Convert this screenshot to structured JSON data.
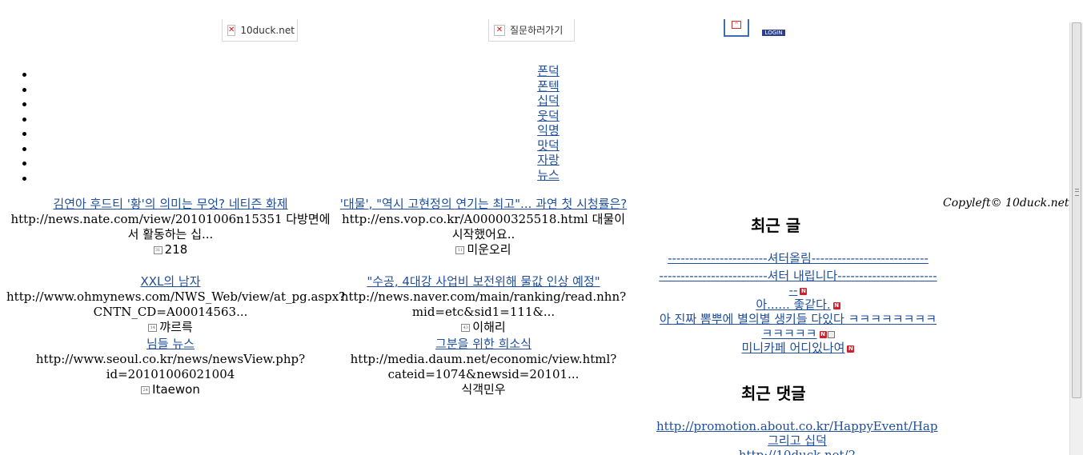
{
  "header": {
    "banner_left_alt": "10duck.net",
    "banner_mid_alt": "질문하러가기",
    "login_label": "LOGIN"
  },
  "nav": {
    "items": [
      "폰덕",
      "폰텍",
      "십덕",
      "웃덕",
      "익명",
      "맛덕",
      "자랑",
      "뉴스"
    ]
  },
  "news": [
    {
      "title": "김연아 후드티 '황'의 의미는 무엇? 네티즌 화제",
      "snippet": "http://news.nate.com/view/20101006n15351 다방면에서 활동하는 십...",
      "author": "218"
    },
    {
      "title": "'대물', \"역시 고현정의 연기는 최고\"... 과연 첫 시청률은?",
      "snippet": "http://ens.vop.co.kr/A00000325518.html 대물이 시작했어요..",
      "author": "미운오리"
    },
    {
      "title": "XXL의 남자",
      "snippet": "http://www.ohmynews.com/NWS_Web/view/at_pg.aspx?CNTN_CD=A00014563...",
      "author": "꺄르륵"
    },
    {
      "title": "\"수공, 4대강 사업비 보전위해 물값 인상 예정\"",
      "snippet": "http://news.naver.com/main/ranking/read.nhn?mid=etc&sid1=111&...",
      "author": "이해리"
    },
    {
      "title": "님들 뉴스",
      "snippet": "http://www.seoul.co.kr/news/newsView.php?id=20101006021004",
      "author": "Itaewon"
    },
    {
      "title": "그분을 위한 희소식",
      "snippet": "http://media.daum.net/economic/view.html?cateid=1074&newsid=20101...",
      "author": "식객민우"
    }
  ],
  "sidebar": {
    "copyleft": "Copyleft© 10duck.net",
    "recent_posts_heading": "최근 글",
    "recent_posts": [
      "-----------------------셔터올림---------------------------",
      "-------------------------셔터 내립니다-------------------------",
      "아...... 좋같다.",
      "아 진짜 뽐뿌에 별의별 생키들 다있다 ㅋㅋㅋㅋㅋㅋㅋㅋㅋㅋㅋㅋㅋ",
      "미니카페 어디있나여"
    ],
    "recent_comments_heading": "최근 댓글",
    "recent_comments": [
      "http://promotion.about.co.kr/HappyEvent/HappyEvent",
      "그리고 십덕",
      "http://10duck.net/2"
    ]
  }
}
